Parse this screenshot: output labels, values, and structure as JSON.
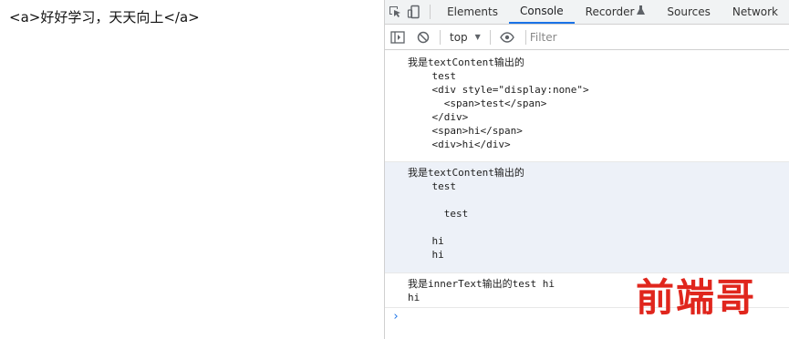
{
  "page": {
    "text": "<a>好好学习，天天向上</a>"
  },
  "devtools": {
    "tabs": [
      "Elements",
      "Console",
      "Recorder",
      "Sources",
      "Network"
    ],
    "active_tab": "Console",
    "toolbar": {
      "context": "top",
      "filter_placeholder": "Filter"
    },
    "console": {
      "messages": [
        {
          "text": "我是textContent输出的\n    test\n    <div style=\"display:none\">\n      <span>test</span>\n    </div>\n    <span>hi</span>\n    <div>hi</div>"
        },
        {
          "text": "我是textContent输出的\n    test\n\n      test\n\n    hi\n    hi"
        },
        {
          "text": "我是innerText输出的test hi\nhi"
        }
      ],
      "prompt_symbol": "›"
    }
  },
  "watermark": "前端哥",
  "icons": {
    "inspect": "inspect-element-icon",
    "device": "device-toolbar-icon",
    "sidebar": "sidebar-toggle-icon",
    "clear": "clear-console-icon",
    "eye": "live-expression-eye-icon",
    "flask": "experimental-flask-icon"
  },
  "colors": {
    "accent": "#1a73e8",
    "highlight_row": "#edf1f8",
    "watermark": "#e0261d"
  }
}
